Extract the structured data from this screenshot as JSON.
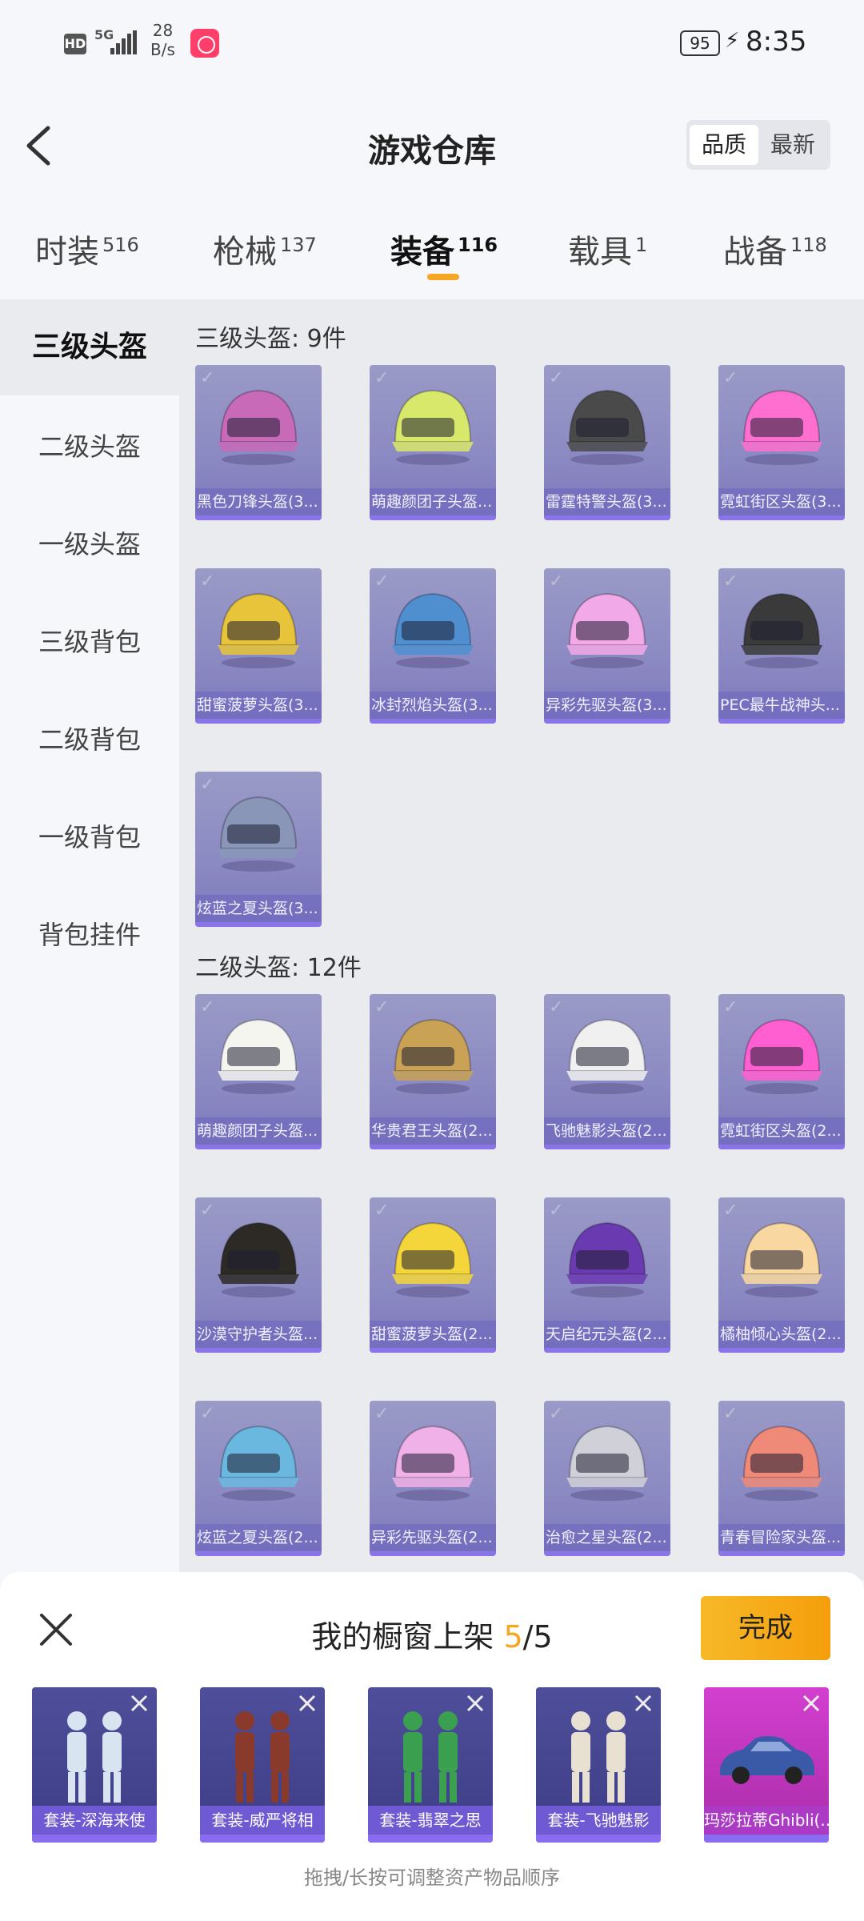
{
  "status_bar": {
    "hd": "HD",
    "network": "5G",
    "speed_value": "28",
    "speed_unit": "B/s",
    "battery": "95",
    "time": "8:35"
  },
  "header": {
    "title": "游戏仓库",
    "sort_options": [
      "品质",
      "最新"
    ],
    "sort_selected": "品质"
  },
  "tabs": [
    {
      "label": "时装",
      "count": "516"
    },
    {
      "label": "枪械",
      "count": "137"
    },
    {
      "label": "装备",
      "count": "116"
    },
    {
      "label": "载具",
      "count": "1"
    },
    {
      "label": "战备",
      "count": "118"
    }
  ],
  "active_tab": "装备",
  "accent_color": "#f5a623",
  "sidebar": {
    "items": [
      "三级头盔",
      "二级头盔",
      "一级头盔",
      "三级背包",
      "二级背包",
      "一级背包",
      "背包挂件"
    ],
    "active": "三级头盔"
  },
  "sections": [
    {
      "title": "三级头盔: 9件",
      "items": [
        {
          "name": "黑色刀锋头盔(3...",
          "icon": "helmet-icon",
          "color": "#c86ab8"
        },
        {
          "name": "萌趣颜团子头盔...",
          "icon": "helmet-icon",
          "color": "#d8e86a"
        },
        {
          "name": "雷霆特警头盔(3...",
          "icon": "helmet-icon",
          "color": "#4a4a4a"
        },
        {
          "name": "霓虹街区头盔(3...",
          "icon": "helmet-icon",
          "color": "#ff6fcf"
        },
        {
          "name": "甜蜜菠萝头盔(3...",
          "icon": "helmet-icon",
          "color": "#e8c43a"
        },
        {
          "name": "冰封烈焰头盔(3...",
          "icon": "helmet-icon",
          "color": "#4f8fd0"
        },
        {
          "name": "异彩先驱头盔(3...",
          "icon": "helmet-icon",
          "color": "#f2a9e8"
        },
        {
          "name": "PEC最牛战神头...",
          "icon": "helmet-icon",
          "color": "#3a3a3a"
        },
        {
          "name": "炫蓝之夏头盔(3...",
          "icon": "helmet-icon",
          "color": "#8a96b8"
        }
      ]
    },
    {
      "title": "二级头盔: 12件",
      "items": [
        {
          "name": "萌趣颜团子头盔...",
          "icon": "helmet-icon",
          "color": "#f5f5f0"
        },
        {
          "name": "华贵君王头盔(2...",
          "icon": "helmet-icon",
          "color": "#c9a256"
        },
        {
          "name": "飞驰魅影头盔(2...",
          "icon": "helmet-icon",
          "color": "#f0f0f0"
        },
        {
          "name": "霓虹街区头盔(2...",
          "icon": "helmet-icon",
          "color": "#ff5fd0"
        },
        {
          "name": "沙漠守护者头盔...",
          "icon": "helmet-icon",
          "color": "#2d2a26"
        },
        {
          "name": "甜蜜菠萝头盔(2...",
          "icon": "helmet-icon",
          "color": "#f5d63a"
        },
        {
          "name": "天启纪元头盔(2...",
          "icon": "helmet-icon",
          "color": "#6a3ab0"
        },
        {
          "name": "橘柚倾心头盔(2...",
          "icon": "helmet-icon",
          "color": "#f8d8a0"
        },
        {
          "name": "炫蓝之夏头盔(2...",
          "icon": "helmet-icon",
          "color": "#6ab8e0"
        },
        {
          "name": "异彩先驱头盔(2...",
          "icon": "helmet-icon",
          "color": "#f0b0e8"
        },
        {
          "name": "治愈之星头盔(2...",
          "icon": "helmet-icon",
          "color": "#d0d0d8"
        },
        {
          "name": "青春冒险家头盔...",
          "icon": "helmet-icon",
          "color": "#f08a78"
        }
      ]
    }
  ],
  "showcase": {
    "title_prefix": "我的橱窗上架 ",
    "count": "5",
    "separator": "/",
    "total": "5",
    "done_label": "完成",
    "hint": "拖拽/长按可调整资产物品顺序",
    "items": [
      {
        "label": "套装-深海来使",
        "icon": "outfit-icon",
        "color": "#d8e4f0"
      },
      {
        "label": "套装-威严将相",
        "icon": "outfit-icon",
        "color": "#8a3a2a"
      },
      {
        "label": "套装-翡翠之思",
        "icon": "outfit-icon",
        "color": "#3aa050"
      },
      {
        "label": "套装-飞驰魅影",
        "icon": "outfit-icon",
        "color": "#e8e0d0"
      },
      {
        "label": "玛莎拉蒂Ghibli(...",
        "icon": "car-icon",
        "color": "#3a5aa8"
      }
    ]
  }
}
